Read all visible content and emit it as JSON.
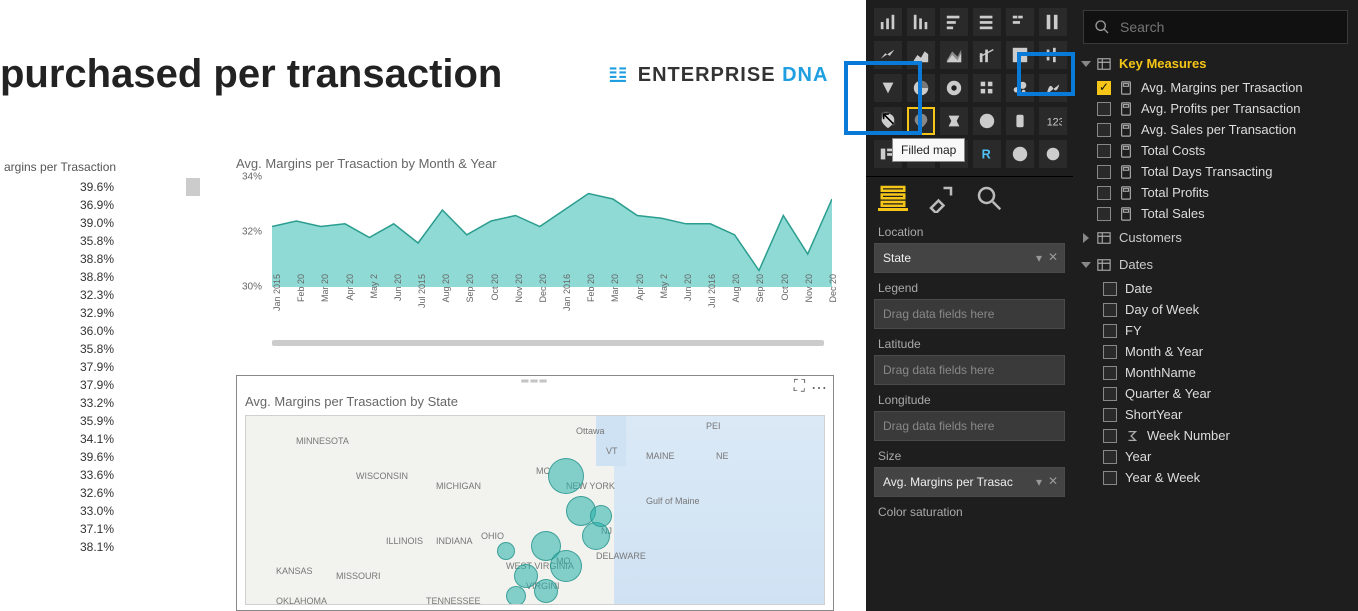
{
  "canvas": {
    "title": "purchased per transaction",
    "logo_prefix": "ENTERPRISE ",
    "logo_suffix": "DNA"
  },
  "table": {
    "header": "argins per Trasaction",
    "rows": [
      "39.6%",
      "36.9%",
      "39.0%",
      "35.8%",
      "38.8%",
      "38.8%",
      "32.3%",
      "32.9%",
      "36.0%",
      "35.8%",
      "37.9%",
      "37.9%",
      "33.2%",
      "35.9%",
      "34.1%",
      "39.6%",
      "33.6%",
      "32.6%",
      "33.0%",
      "37.1%",
      "38.1%"
    ]
  },
  "chart_data": {
    "type": "line",
    "title": "Avg. Margins per Trasaction by Month & Year",
    "ylabel": "",
    "xlabel": "",
    "ylim": [
      30,
      34
    ],
    "y_ticks": [
      "34%",
      "32%",
      "30%"
    ],
    "categories": [
      "Jan 2015",
      "Feb 20",
      "Mar 20",
      "Apr 20",
      "May 2",
      "Jun 20",
      "Jul 2015",
      "Aug 20",
      "Sep 20",
      "Oct 20",
      "Nov 20",
      "Dec 20",
      "Jan 2016",
      "Feb 20",
      "Mar 20",
      "Apr 20",
      "May 2",
      "Jun 20",
      "Jul 2016",
      "Aug 20",
      "Sep 20",
      "Oct 20",
      "Nov 20",
      "Dec 20"
    ],
    "values": [
      32.2,
      32.4,
      32.2,
      32.3,
      31.8,
      32.3,
      31.6,
      32.8,
      31.9,
      32.4,
      32.6,
      32.2,
      32.8,
      33.4,
      33.2,
      32.6,
      32.5,
      32.3,
      32.3,
      31.9,
      30.6,
      32.6,
      31.2,
      33.2
    ]
  },
  "map": {
    "title": "Avg. Margins per Trasaction by State",
    "labels": [
      "MINNESOTA",
      "WISCONSIN",
      "MICHIGAN",
      "ILLINOIS",
      "INDIANA",
      "OHIO",
      "KANSAS",
      "MISSOURI",
      "OKLAHOMA",
      "TENNESSEE",
      "WEST VIRGINIA",
      "VIRGINI",
      "DELAWARE",
      "MO",
      "NEW YORK",
      "VT",
      "MAINE",
      "Gulf of Maine",
      "NJ",
      "PEI",
      "NE",
      "Ottawa",
      "MC"
    ]
  },
  "viz": {
    "tooltip": "Filled map",
    "tabs": {
      "fields": "Fields",
      "format": "Format",
      "analytics": "Analytics"
    },
    "wells": {
      "location_label": "Location",
      "location_value": "State",
      "legend_label": "Legend",
      "legend_value": "Drag data fields here",
      "latitude_label": "Latitude",
      "latitude_value": "Drag data fields here",
      "longitude_label": "Longitude",
      "longitude_value": "Drag data fields here",
      "size_label": "Size",
      "size_value": "Avg. Margins per Trasac",
      "colorsat_label": "Color saturation"
    }
  },
  "fields": {
    "search_placeholder": "Search",
    "key_measures_label": "Key Measures",
    "measures": [
      {
        "label": "Avg. Margins per Trasaction",
        "checked": true
      },
      {
        "label": "Avg. Profits per Transaction",
        "checked": false
      },
      {
        "label": "Avg. Sales per Transaction",
        "checked": false
      },
      {
        "label": "Total Costs",
        "checked": false
      },
      {
        "label": "Total Days Transacting",
        "checked": false
      },
      {
        "label": "Total Profits",
        "checked": false
      },
      {
        "label": "Total Sales",
        "checked": false
      }
    ],
    "customers_label": "Customers",
    "dates_label": "Dates",
    "date_fields": [
      {
        "label": "Date",
        "sigma": false
      },
      {
        "label": "Day of Week",
        "sigma": false
      },
      {
        "label": "FY",
        "sigma": false
      },
      {
        "label": "Month & Year",
        "sigma": false
      },
      {
        "label": "MonthName",
        "sigma": false
      },
      {
        "label": "Quarter & Year",
        "sigma": false
      },
      {
        "label": "ShortYear",
        "sigma": false
      },
      {
        "label": "Week Number",
        "sigma": true
      },
      {
        "label": "Year",
        "sigma": false
      },
      {
        "label": "Year & Week",
        "sigma": false
      }
    ]
  }
}
